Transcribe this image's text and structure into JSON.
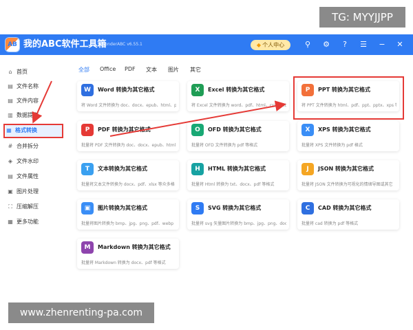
{
  "watermarks": {
    "top": "TG: MYYJJPP",
    "bottom": "www.zhenrenting-pa.com"
  },
  "titlebar": {
    "logo": "AB",
    "title": "我的ABC软件工具箱",
    "version": "WonderABC v6.55.1",
    "user_center": "个人中心",
    "icons": [
      "search-icon",
      "settings-icon",
      "help-icon",
      "menu-icon",
      "minimize-icon",
      "close-icon"
    ]
  },
  "sidebar": {
    "items": [
      {
        "icon": "⌂",
        "label": "首页"
      },
      {
        "icon": "▤",
        "label": "文件名称"
      },
      {
        "icon": "▤",
        "label": "文件内容"
      },
      {
        "icon": "▥",
        "label": "数据提取"
      },
      {
        "icon": "▦",
        "label": "格式转换"
      },
      {
        "icon": "#",
        "label": "合并拆分"
      },
      {
        "icon": "◈",
        "label": "文件水印"
      },
      {
        "icon": "▤",
        "label": "文件属性"
      },
      {
        "icon": "▣",
        "label": "图片处理"
      },
      {
        "icon": "⛶",
        "label": "压缩解压"
      },
      {
        "icon": "▦",
        "label": "更多功能"
      }
    ]
  },
  "tabs": [
    "全部",
    "Office",
    "PDF",
    "文本",
    "图片",
    "其它"
  ],
  "cards": [
    {
      "icon": "W",
      "color": "#2f6fe0",
      "title": "Word 转换为其它格式",
      "desc": "将 Word 文件转换为 doc、docx、epub、html、pd"
    },
    {
      "icon": "X",
      "color": "#1f9d55",
      "title": "Excel 转换为其它格式",
      "desc": "将 Excel 文件转换为 word、pdf、html、csv、txt"
    },
    {
      "icon": "P",
      "color": "#f2703a",
      "title": "PPT 转换为其它格式",
      "desc": "将 PPT 文件转换为 html、pdf、ppt、pptx、xps 等。"
    },
    {
      "icon": "P",
      "color": "#e53935",
      "title": "PDF 转换为其它格式",
      "desc": "批量将 PDF 文件转换为 doc、docx、epub、html"
    },
    {
      "icon": "O",
      "color": "#18a874",
      "title": "OFD 转换为其它格式",
      "desc": "批量将 OFD 文件转换为 pdf 等格式"
    },
    {
      "icon": "X",
      "color": "#3a8ef6",
      "title": "XPS 转换为其它格式",
      "desc": "批量将 XPS 文件转换为 pdf 格式"
    },
    {
      "icon": "T",
      "color": "#3aa0f0",
      "title": "文本转换为其它格式",
      "desc": "批量将文本文件转换为 docx、pdf、xlsx 等众多格"
    },
    {
      "icon": "H",
      "color": "#17a2a2",
      "title": "HTML 转换为其它格式",
      "desc": "批量将 Html 转换为 txt、docx、pdf 等格式"
    },
    {
      "icon": "J",
      "color": "#f5a623",
      "title": "JSON 转换为其它格式",
      "desc": "批量将 JSON 文件转换为可视化的情绪导图或其它"
    },
    {
      "icon": "▣",
      "color": "#3a8ef6",
      "title": "图片转换为其它格式",
      "desc": "批量将图片转换为 bmp、jpg、png、pdf、webp"
    },
    {
      "icon": "S",
      "color": "#2f7bf3",
      "title": "SVG 转换为其它格式",
      "desc": "批量将 svg 矢量图片转换为 bmp、jpg、png、doc"
    },
    {
      "icon": "C",
      "color": "#2f6fe0",
      "title": "CAD 转换为其它格式",
      "desc": "批量将 cad 转换为 pdf 等格式"
    },
    {
      "icon": "M",
      "color": "#8e44ad",
      "title": "Markdown 转换为其它格式",
      "desc": "批量将 Markdown 转换为 docx、pdf 等格式"
    }
  ],
  "colors": {
    "accent": "#2f7bf3",
    "annotation": "#e53935"
  }
}
